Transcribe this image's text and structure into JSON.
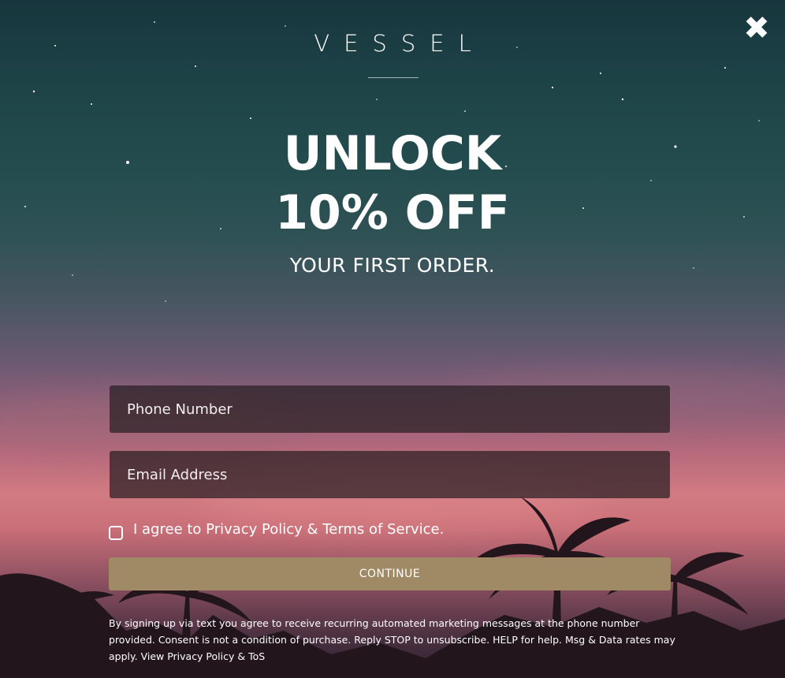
{
  "popup": {
    "close_label": "✖",
    "brand": "VESSEL",
    "headline_line1": "UNLOCK",
    "headline_line2": "10% OFF",
    "subheadline": "YOUR FIRST ORDER."
  },
  "form": {
    "phone_placeholder": "Phone Number",
    "email_placeholder": "Email Address",
    "agree_label": "I agree to Privacy Policy & Terms of Service.",
    "agree_checked": false,
    "continue_label": "CONTINUE"
  },
  "disclaimer": "By signing up via text you agree to receive recurring automated marketing messages at the phone number provided. Consent is not a condition of purchase. Reply STOP to unsubscribe. HELP for help. Msg & Data rates may apply. View Privacy Policy & ToS",
  "colors": {
    "button": "#a08a66",
    "field_background": "rgba(40,30,34,0.72)",
    "text": "#ffffff"
  }
}
